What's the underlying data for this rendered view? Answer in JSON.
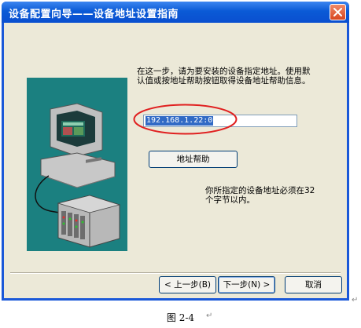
{
  "window": {
    "title": "设备配置向导——设备地址设置指南"
  },
  "content": {
    "instruction": "在这一步，请为要安装的设备指定地址。使用默认值或按地址帮助按钮取得设备地址帮助信息。",
    "address_value": "192.168.1.22:0",
    "help_button_label": "地址帮助",
    "note": "你所指定的设备地址必须在32个字节以内。"
  },
  "footer": {
    "back_label": "< 上一步(B)",
    "next_label": "下一步(N) >",
    "cancel_label": "取消"
  },
  "caption": "图 2-4",
  "icons": {
    "close": "close-icon",
    "computer": "computer-icon",
    "device": "device-rack-icon"
  },
  "colors": {
    "title_bar": "#0a5ad6",
    "dialog_bg": "#ece9d8",
    "illustration_bg": "#1b8080",
    "selection": "#316ac5",
    "highlight_oval": "#e02020"
  }
}
